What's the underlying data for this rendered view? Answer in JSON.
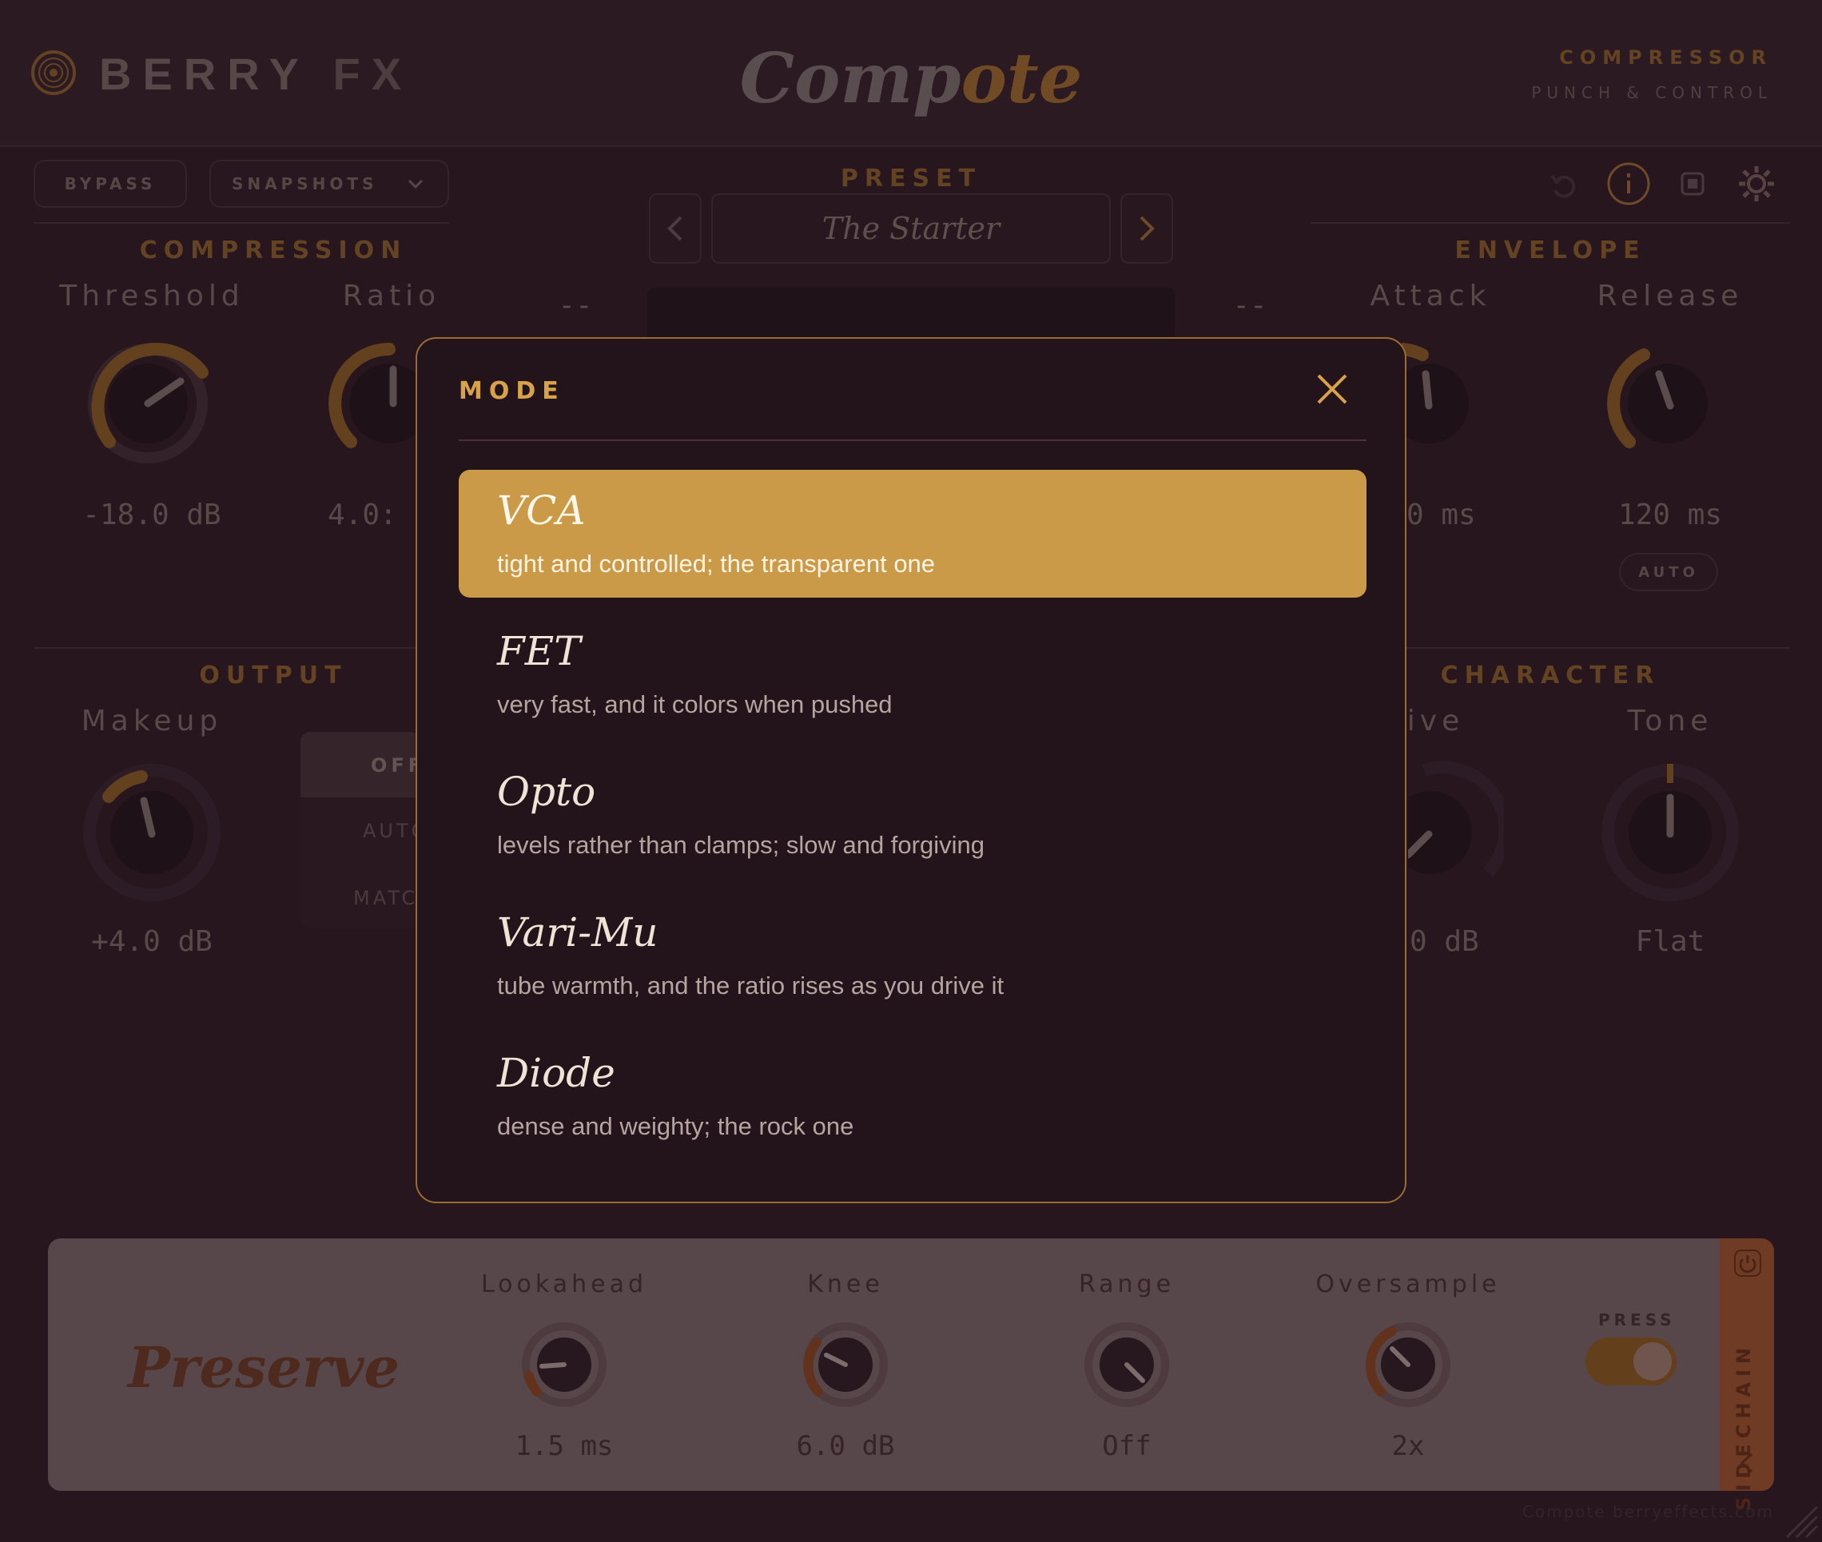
{
  "header": {
    "brand_main": "BERRY",
    "brand_fx": "FX",
    "title_a": "Comp",
    "title_b": "ote",
    "category": "COMPRESSOR",
    "subtitle": "PUNCH & CONTROL"
  },
  "toolbar": {
    "bypass": "BYPASS",
    "snapshots": "SNAPSHOTS",
    "preset_label": "PRESET",
    "preset_name": "The Starter"
  },
  "compression": {
    "title": "COMPRESSION",
    "threshold_label": "Threshold",
    "threshold_value": "-18.0 dB",
    "ratio_label": "Ratio",
    "ratio_value": "4.0:"
  },
  "meter": {
    "left_readout": "--",
    "right_readout": "--"
  },
  "envelope": {
    "title": "ENVELOPE",
    "attack_label": "Attack",
    "attack_value": "0 ms",
    "release_label": "Release",
    "release_value": "120 ms",
    "auto": "AUTO"
  },
  "output": {
    "title": "OUTPUT",
    "makeup_label": "Makeup",
    "makeup_value": "+4.0 dB",
    "mode_off": "OFF",
    "mode_auto": "AUTO",
    "mode_match": "MATC"
  },
  "character": {
    "title": "CHARACTER",
    "drive_label": "rive",
    "drive_value": "0 dB",
    "tone_label": "Tone",
    "tone_value": "Flat"
  },
  "bottom": {
    "title": "Preserve",
    "lookahead_label": "Lookahead",
    "lookahead_value": "1.5 ms",
    "knee_label": "Knee",
    "knee_value": "6.0 dB",
    "range_label": "Range",
    "range_value": "Off",
    "oversample_label": "Oversample",
    "oversample_value": "2x",
    "press_label": "PRESS",
    "sidechain": "SIDECHAIN"
  },
  "footer": "Compote  berryeffects.com",
  "modal": {
    "title": "MODE",
    "options": [
      {
        "name": "VCA",
        "desc": "tight and controlled; the transparent one",
        "selected": true
      },
      {
        "name": "FET",
        "desc": "very fast, and it colors when pushed",
        "selected": false
      },
      {
        "name": "Opto",
        "desc": "levels rather than clamps; slow and forgiving",
        "selected": false
      },
      {
        "name": "Vari-Mu",
        "desc": "tube warmth, and the ratio rises as you drive it",
        "selected": false
      },
      {
        "name": "Diode",
        "desc": "dense and weighty; the rock one",
        "selected": false
      }
    ]
  },
  "colors": {
    "accent": "#cb9a48",
    "modal_border": "#9a6c34",
    "background": "#2a1820"
  }
}
